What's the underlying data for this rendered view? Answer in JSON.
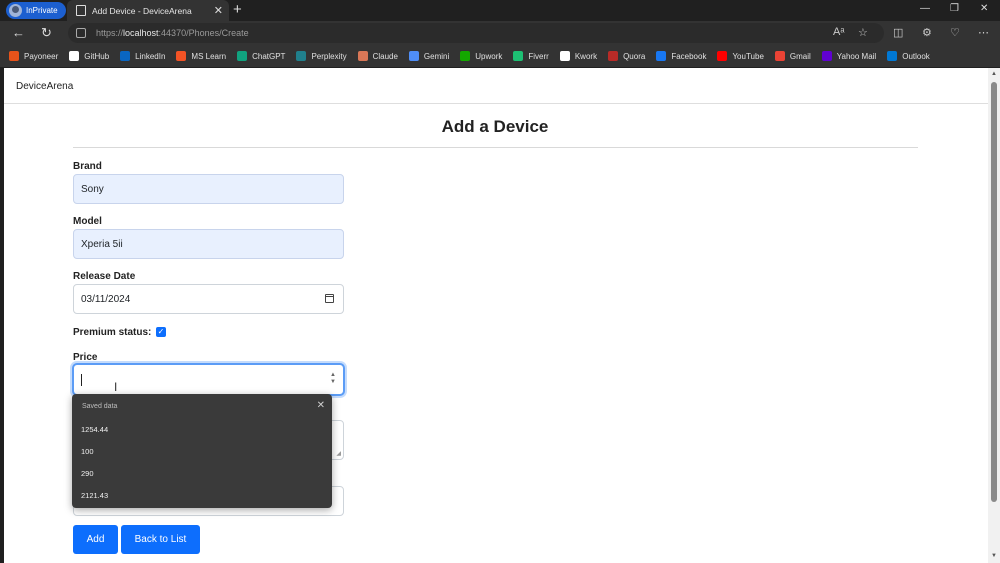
{
  "browser": {
    "inprivate_label": "InPrivate",
    "tab_title": "Add Device - DeviceArena",
    "url_prefix": "https://",
    "url_host": "localhost",
    "url_rest": ":44370/Phones/Create",
    "favorites": [
      {
        "label": "Payoneer",
        "color": "#e8531a"
      },
      {
        "label": "GitHub",
        "color": "#ffffff"
      },
      {
        "label": "LinkedIn",
        "color": "#0a66c2"
      },
      {
        "label": "MS Learn",
        "color": "#f35325"
      },
      {
        "label": "ChatGPT",
        "color": "#10a37f"
      },
      {
        "label": "Perplexity",
        "color": "#20808d"
      },
      {
        "label": "Claude",
        "color": "#d97757"
      },
      {
        "label": "Gemini",
        "color": "#4f8ef7"
      },
      {
        "label": "Upwork",
        "color": "#14a800"
      },
      {
        "label": "Fiverr",
        "color": "#1dbf73"
      },
      {
        "label": "Kwork",
        "color": "#ffffff"
      },
      {
        "label": "Quora",
        "color": "#b92b27"
      },
      {
        "label": "Facebook",
        "color": "#1877f2"
      },
      {
        "label": "YouTube",
        "color": "#ff0000"
      },
      {
        "label": "Gmail",
        "color": "#ea4335"
      },
      {
        "label": "Yahoo Mail",
        "color": "#6001d2"
      },
      {
        "label": "Outlook",
        "color": "#0078d4"
      }
    ]
  },
  "page": {
    "brand": "DeviceArena",
    "title": "Add a Device"
  },
  "form": {
    "brand_label": "Brand",
    "brand_value": "Sony",
    "model_label": "Model",
    "model_value": "Xperia 5ii",
    "release_label": "Release Date",
    "release_value": "03/11/2024",
    "premium_label": "Premium status:",
    "price_label": "Price"
  },
  "autofill": {
    "header": "Saved data",
    "items": [
      "1254.44",
      "100",
      "290",
      "2121.43"
    ]
  },
  "buttons": {
    "add": "Add",
    "back": "Back to List"
  }
}
